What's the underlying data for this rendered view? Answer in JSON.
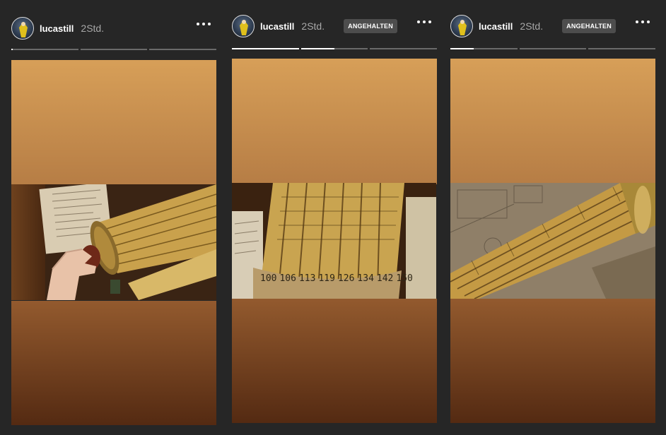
{
  "stories": [
    {
      "username": "lucastill",
      "time": "2Std.",
      "badge": "",
      "progress": [
        0.02,
        0,
        0
      ],
      "more_icon": "more-horizontal-icon"
    },
    {
      "username": "lucastill",
      "time": "2Std.",
      "badge": "ANGEHALTEN",
      "progress": [
        1,
        0.5,
        0
      ],
      "more_icon": "more-horizontal-icon"
    },
    {
      "username": "lucastill",
      "time": "2Std.",
      "badge": "ANGEHALTEN",
      "progress": [
        0.35,
        0,
        0
      ],
      "more_icon": "more-horizontal-icon"
    }
  ],
  "scale_numbers": [
    "100",
    "106",
    "113",
    "119",
    "126",
    "134",
    "142",
    "150"
  ],
  "colors": {
    "background": "#262626",
    "gradient_top": "#d79f58",
    "gradient_bottom": "#542a12",
    "brass": "#c8a04a",
    "progress_active": "#ffffff",
    "progress_inactive": "#6a6a6a"
  }
}
